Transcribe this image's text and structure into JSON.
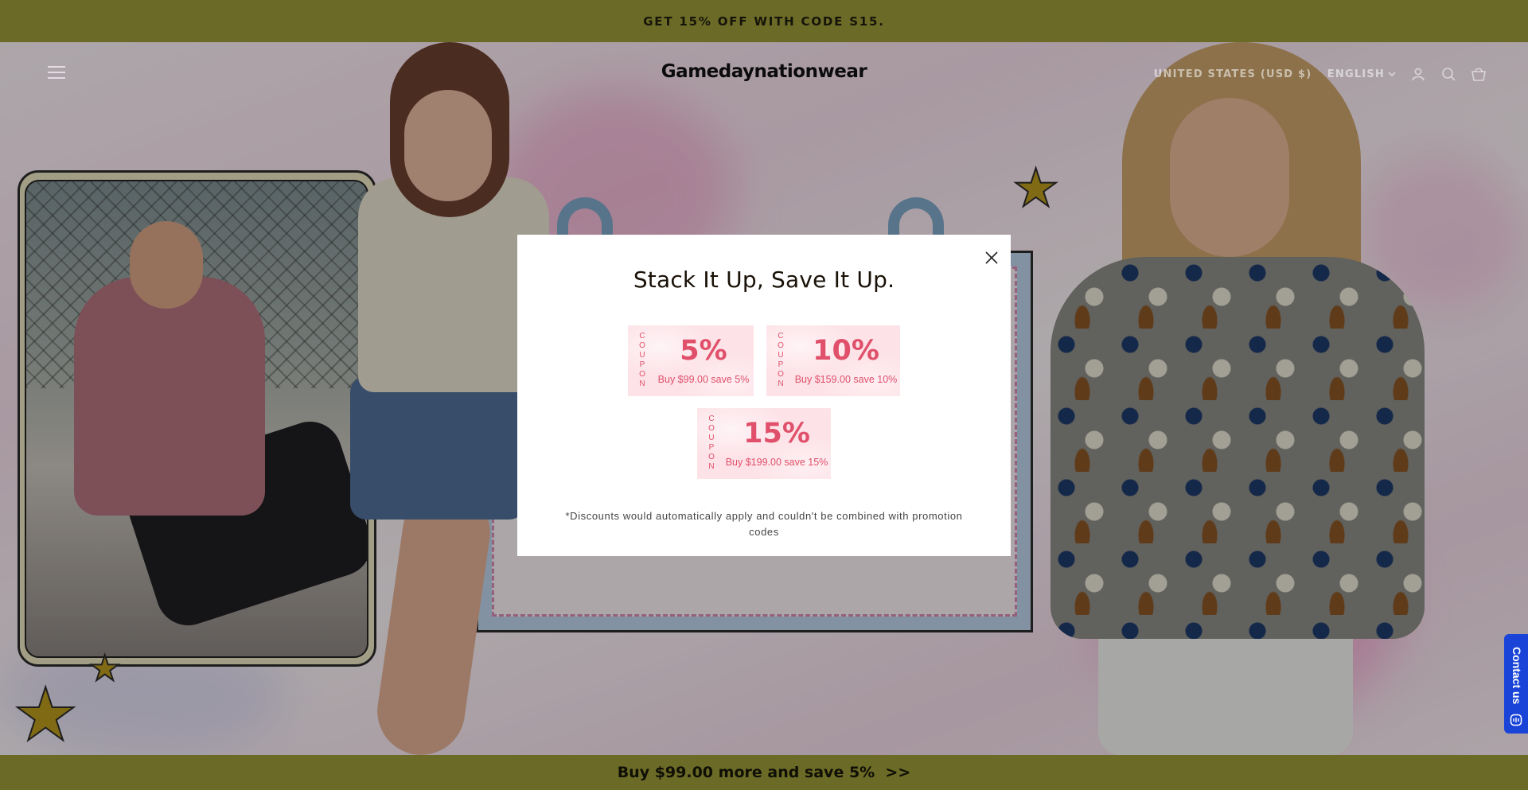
{
  "announcement": {
    "text": "GET 15% OFF WITH CODE S15."
  },
  "header": {
    "logo": "Gamedaynationwear",
    "currency": "UNITED STATES (USD $)",
    "language": "ENGLISH"
  },
  "icons": {
    "menu": "hamburger-menu-icon",
    "account": "user-icon",
    "search": "search-icon",
    "cart": "cart-icon",
    "close": "close-icon",
    "chat": "chat-icon"
  },
  "modal": {
    "title": "Stack It Up, Save It Up.",
    "coupons": [
      {
        "label": "COUPON",
        "percent": "5%",
        "description": "Buy $99.00 save 5%"
      },
      {
        "label": "COUPON",
        "percent": "10%",
        "description": "Buy $159.00 save 10%"
      },
      {
        "label": "COUPON",
        "percent": "15%",
        "description": "Buy $199.00 save 15%"
      }
    ],
    "disclaimer": "*Discounts would automatically apply and couldn't be combined with promotion codes"
  },
  "bottom_bar": {
    "text": "Buy $99.00 more and save 5%  >>"
  },
  "contact": {
    "label": "Contact us"
  },
  "colors": {
    "bar": "#6b6a26",
    "coupon_bg": "#fde3e8",
    "coupon_text": "#e0506a",
    "contact": "#1a44d8"
  }
}
